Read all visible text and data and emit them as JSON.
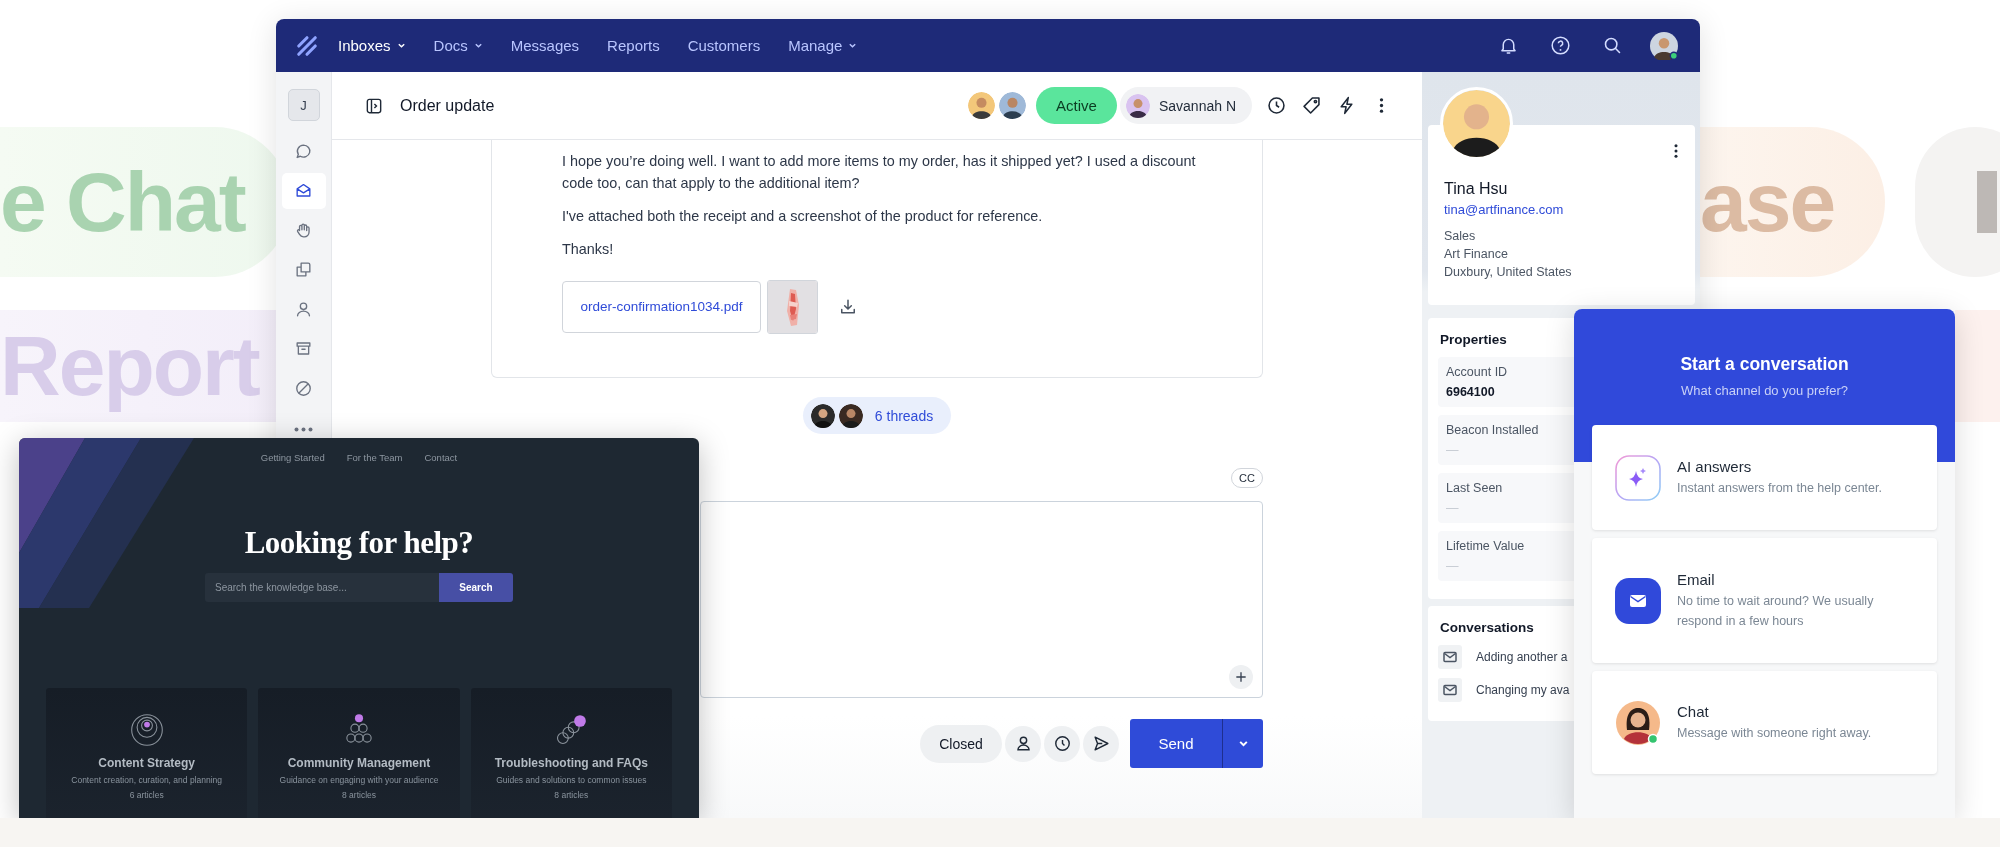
{
  "backdrop_words": [
    {
      "text": "e Chat",
      "color": "#a9d3b0"
    },
    {
      "text": "Report",
      "color": "#d8cdea"
    },
    {
      "text": "ase",
      "color": "#dcbba3"
    }
  ],
  "app": {
    "nav": {
      "items": [
        {
          "label": "Inboxes",
          "dropdown": true,
          "selected": true
        },
        {
          "label": "Docs",
          "dropdown": true,
          "selected": false
        },
        {
          "label": "Messages",
          "dropdown": false,
          "selected": false
        },
        {
          "label": "Reports",
          "dropdown": false,
          "selected": false
        },
        {
          "label": "Customers",
          "dropdown": false,
          "selected": false
        },
        {
          "label": "Manage",
          "dropdown": true,
          "selected": false
        }
      ]
    },
    "rail": {
      "workspace": "J",
      "items": [
        {
          "kind": "chat",
          "selected": false
        },
        {
          "kind": "inbox",
          "selected": true
        },
        {
          "kind": "hand",
          "selected": false
        },
        {
          "kind": "copy",
          "selected": false
        },
        {
          "kind": "person",
          "selected": false
        },
        {
          "kind": "archive",
          "selected": false
        },
        {
          "kind": "block",
          "selected": false
        },
        {
          "kind": "more",
          "selected": false
        }
      ]
    },
    "conversation": {
      "title": "Order update",
      "status": "Active",
      "assignee": "Savannah N",
      "message": {
        "paragraphs": [
          "I hope you’re doing well. I want to add more items to my order, has it shipped yet? I used a discount code too, can that apply to the additional item?",
          "I've attached both the receipt and a screenshot of the product for reference.",
          "Thanks!"
        ],
        "attachment": "order-confirmation1034.pdf"
      },
      "threads": "6 threads",
      "cc": "CC",
      "status_button": "Closed",
      "send": "Send"
    },
    "customer": {
      "name": "Tina Hsu",
      "email": "tina@artfinance.com",
      "details": [
        "Sales",
        "Art Finance",
        "Duxbury, United States"
      ],
      "properties_title": "Properties",
      "properties": [
        {
          "label": "Account ID",
          "value": "6964100"
        },
        {
          "label": "Beacon Installed",
          "value": "—"
        },
        {
          "label": "Last Seen",
          "value": "—"
        },
        {
          "label": "Lifetime Value",
          "value": "—"
        }
      ],
      "conversations_title": "Conversations",
      "conversations": [
        "Adding another a",
        "Changing my ava"
      ]
    }
  },
  "help_center": {
    "links": [
      "Getting Started",
      "For the Team",
      "Contact"
    ],
    "title": "Looking for help?",
    "search_placeholder": "Search the knowledge base...",
    "search_button": "Search",
    "categories": [
      {
        "kind": "target",
        "title": "Content Strategy",
        "description": "Content creation, curation, and planning",
        "count": "6 articles"
      },
      {
        "kind": "pyramid",
        "title": "Community Management",
        "description": "Guidance on engaging with your audience",
        "count": "8 articles"
      },
      {
        "kind": "chain",
        "title": "Troubleshooting and FAQs",
        "description": "Guides and solutions to common issues",
        "count": "8 articles"
      }
    ]
  },
  "beacon": {
    "title": "Start a conversation",
    "subtitle": "What channel do you prefer?",
    "options": [
      {
        "kind": "ai",
        "title": "AI answers",
        "description": "Instant answers from the help center."
      },
      {
        "kind": "email",
        "title": "Email",
        "description": "No time to wait around? We usually respond in a few hours"
      },
      {
        "kind": "chat",
        "title": "Chat",
        "description": "Message with someone right away."
      }
    ]
  }
}
